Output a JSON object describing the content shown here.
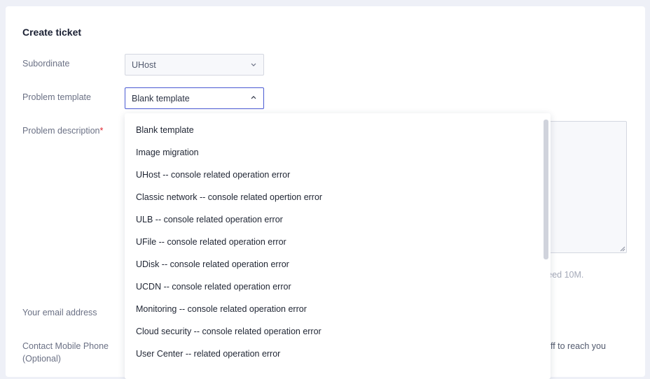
{
  "form": {
    "title": "Create ticket",
    "subordinate_label": "Subordinate",
    "subordinate_value": "UHost",
    "template_label": "Problem template",
    "template_value": "Blank template",
    "description_label": "Problem description",
    "required_mark": "*",
    "email_label": "Your email address",
    "phone_label_line1": "Contact Mobile Phone",
    "phone_label_line2": "(Optional)",
    "upload_hint_fragment": "ceed 10M.",
    "phone_hint_fragment": "uff to reach you"
  },
  "dropdown": {
    "options": [
      "Blank template",
      "Image migration",
      "UHost -- console related operation error",
      "Classic network -- console related opertion error",
      "ULB -- console related operation error",
      "UFile -- console related operation error",
      "UDisk -- console related operation error",
      "UCDN -- console related operation error",
      "Monitoring -- console related operation error",
      "Cloud security -- console related operation error",
      "User Center -- related operation error"
    ]
  },
  "icons": {
    "subordinate_chevron": "chevron-down-icon",
    "template_chevron": "chevron-up-icon"
  },
  "colors": {
    "accent_border": "#4a5ad3",
    "required": "#e0242f",
    "background": "#eef0f7"
  }
}
